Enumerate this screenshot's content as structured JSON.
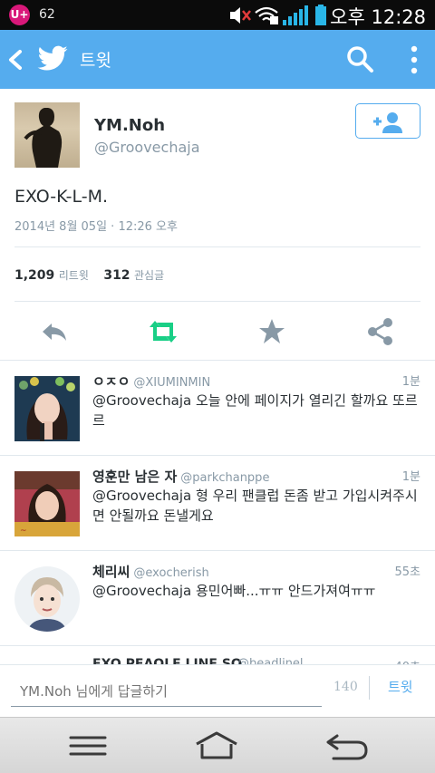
{
  "status_bar": {
    "carrier": "U+",
    "notification_count": "62",
    "time": "오후 12:28"
  },
  "header": {
    "title": "트윗"
  },
  "tweet": {
    "author_name": "YM.Noh",
    "author_handle": "@Groovechaja",
    "text": "EXO-K-L-M.",
    "date": "2014년 8월 05일 · 12:26 오후",
    "retweet_count": "1,209",
    "retweet_label": "리트윗",
    "favorite_count": "312",
    "favorite_label": "관심글"
  },
  "replies": [
    {
      "name": "ㅇㅈㅇ",
      "handle": "@XIUMINMIN",
      "time": "1분",
      "text": "@Groovechaja 오늘 안에 페이지가 열리긴 할까요 또르르"
    },
    {
      "name": "영훈만 남은 자",
      "handle": "@parkchanppe",
      "time": "1분",
      "text": "@Groovechaja 형 우리 팬클럽 돈좀 받고 가입시켜주시면 안될까요 돈낼게요"
    },
    {
      "name": "체리씨",
      "handle": "@exocherish",
      "time": "55초",
      "text": "@Groovechaja 용민어빠...ㅠㅠ 안드가져여ㅠㅠ"
    }
  ],
  "partial_reply": {
    "name": "EXO PEAOLE LINE SQ",
    "handle": "@beadlinel...",
    "time": "40초"
  },
  "composer": {
    "placeholder": "YM.Noh 님에게 답글하기",
    "char_count": "140",
    "tweet_label": "트윗"
  },
  "colors": {
    "brand": "#55acee",
    "retweet_green": "#19cf86",
    "icon_gray": "#8899a6"
  }
}
